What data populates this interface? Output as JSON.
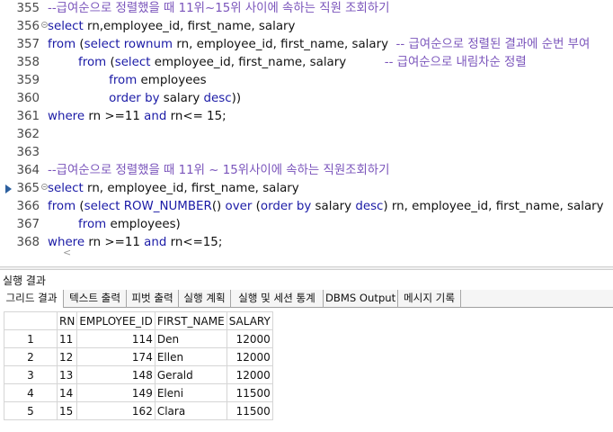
{
  "editor": {
    "lines": [
      {
        "num": "355",
        "fold": false,
        "marker": false,
        "segments": [
          {
            "t": "--급여순으로 정렬했을 때 11위~15위 사이에 속하는 직원 조회하기",
            "c": "cm"
          }
        ]
      },
      {
        "num": "356",
        "fold": true,
        "marker": false,
        "segments": [
          {
            "t": "select ",
            "c": "kw"
          },
          {
            "t": "rn,employee_id, first_name, salary",
            "c": "tx"
          }
        ]
      },
      {
        "num": "357",
        "fold": false,
        "marker": false,
        "segments": [
          {
            "t": "from ",
            "c": "kw"
          },
          {
            "t": "(",
            "c": "tx"
          },
          {
            "t": "select rownum ",
            "c": "kw"
          },
          {
            "t": "rn, employee_id, first_name, salary  ",
            "c": "tx"
          },
          {
            "t": "-- 급여순으로 정렬된 결과에 순번 부여",
            "c": "cm"
          }
        ]
      },
      {
        "num": "358",
        "fold": false,
        "marker": false,
        "segments": [
          {
            "t": "        from ",
            "c": "kw"
          },
          {
            "t": "(",
            "c": "tx"
          },
          {
            "t": "select ",
            "c": "kw"
          },
          {
            "t": "employee_id, first_name, salary          ",
            "c": "tx"
          },
          {
            "t": "-- 급여순으로 내림차순 정렬",
            "c": "cm"
          }
        ]
      },
      {
        "num": "359",
        "fold": false,
        "marker": false,
        "segments": [
          {
            "t": "                from ",
            "c": "kw"
          },
          {
            "t": "employees",
            "c": "tx"
          }
        ]
      },
      {
        "num": "360",
        "fold": false,
        "marker": false,
        "segments": [
          {
            "t": "                order by ",
            "c": "kw"
          },
          {
            "t": "salary ",
            "c": "tx"
          },
          {
            "t": "desc",
            "c": "kw"
          },
          {
            "t": "))",
            "c": "tx"
          }
        ]
      },
      {
        "num": "361",
        "fold": false,
        "marker": false,
        "segments": [
          {
            "t": "where ",
            "c": "kw"
          },
          {
            "t": "rn >=11 ",
            "c": "tx"
          },
          {
            "t": "and ",
            "c": "kw"
          },
          {
            "t": "rn<= 15;",
            "c": "tx"
          }
        ]
      },
      {
        "num": "362",
        "fold": false,
        "marker": false,
        "segments": []
      },
      {
        "num": "363",
        "fold": false,
        "marker": false,
        "segments": []
      },
      {
        "num": "364",
        "fold": false,
        "marker": false,
        "segments": [
          {
            "t": "--급여순으로 정렬했을 때 11위 ~ 15위사이에 속하는 직원조회하기",
            "c": "cm"
          }
        ]
      },
      {
        "num": "365",
        "fold": true,
        "marker": true,
        "segments": [
          {
            "t": "select ",
            "c": "kw"
          },
          {
            "t": "rn, employee_id, first_name, salary",
            "c": "tx"
          }
        ]
      },
      {
        "num": "366",
        "fold": false,
        "marker": false,
        "segments": [
          {
            "t": "from ",
            "c": "kw"
          },
          {
            "t": "(",
            "c": "tx"
          },
          {
            "t": "select ROW_NUMBER",
            "c": "kw"
          },
          {
            "t": "() ",
            "c": "tx"
          },
          {
            "t": "over ",
            "c": "kw"
          },
          {
            "t": "(",
            "c": "tx"
          },
          {
            "t": "order by ",
            "c": "kw"
          },
          {
            "t": "salary ",
            "c": "tx"
          },
          {
            "t": "desc",
            "c": "kw"
          },
          {
            "t": ") rn, employee_id, first_name, salary",
            "c": "tx"
          }
        ]
      },
      {
        "num": "367",
        "fold": false,
        "marker": false,
        "segments": [
          {
            "t": "        from ",
            "c": "kw"
          },
          {
            "t": "employees)",
            "c": "tx"
          }
        ]
      },
      {
        "num": "368",
        "fold": false,
        "marker": false,
        "segments": [
          {
            "t": "where ",
            "c": "kw"
          },
          {
            "t": "rn >=11 ",
            "c": "tx"
          },
          {
            "t": "and ",
            "c": "kw"
          },
          {
            "t": "rn<=15;",
            "c": "tx"
          }
        ]
      }
    ],
    "collapse_glyph": "<"
  },
  "results": {
    "title": "실행 결과",
    "tabs": [
      "그리드 결과",
      "텍스트 출력",
      "피벗 출력",
      "실행 계획",
      "실행 및 세션 통계",
      "DBMS Output",
      "메시지 기록"
    ],
    "columns": [
      "RN",
      "EMPLOYEE_ID",
      "FIRST_NAME",
      "SALARY"
    ],
    "rows": [
      {
        "n": "1",
        "rn": "11",
        "id": "114",
        "name": "Den",
        "salary": "12000"
      },
      {
        "n": "2",
        "rn": "12",
        "id": "174",
        "name": "Ellen",
        "salary": "12000"
      },
      {
        "n": "3",
        "rn": "13",
        "id": "148",
        "name": "Gerald",
        "salary": "12000"
      },
      {
        "n": "4",
        "rn": "14",
        "id": "149",
        "name": "Eleni",
        "salary": "11500"
      },
      {
        "n": "5",
        "rn": "15",
        "id": "162",
        "name": "Clara",
        "salary": "11500"
      }
    ]
  }
}
